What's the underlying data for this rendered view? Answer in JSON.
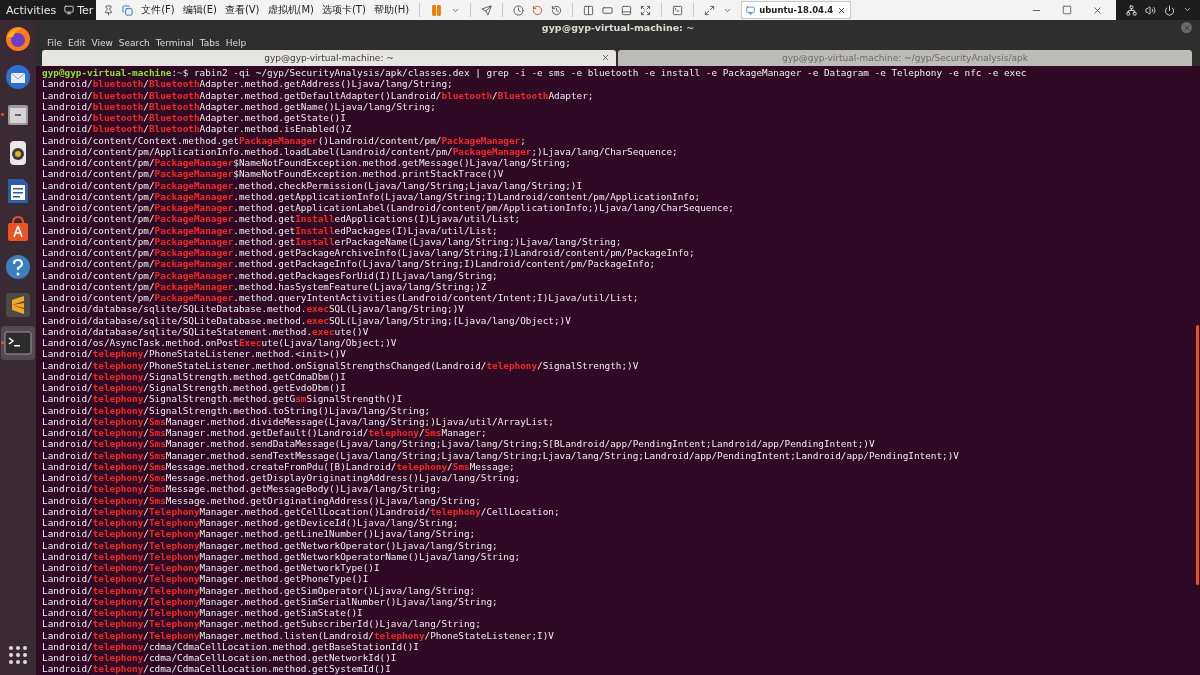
{
  "top_bar": {
    "activities": "Activities",
    "app_menu": "Ter"
  },
  "vm_toolbar": {
    "menus": [
      "文件(F)",
      "编辑(E)",
      "查看(V)",
      "虚拟机(M)",
      "选项卡(T)",
      "帮助(H)"
    ],
    "tab": "ubuntu-18.04.4"
  },
  "dock": [
    {
      "kind": "browser",
      "running": false,
      "selected": false
    },
    {
      "kind": "mail",
      "running": false,
      "selected": false
    },
    {
      "kind": "files",
      "running": true,
      "selected": false
    },
    {
      "kind": "speaker",
      "running": false,
      "selected": false
    },
    {
      "kind": "document",
      "running": false,
      "selected": false
    },
    {
      "kind": "store",
      "running": false,
      "selected": false
    },
    {
      "kind": "help",
      "running": false,
      "selected": false
    },
    {
      "kind": "editor",
      "running": false,
      "selected": false
    },
    {
      "kind": "terminal",
      "running": true,
      "selected": true
    }
  ],
  "terminal": {
    "title": "gyp@gyp-virtual-machine: ~",
    "menu": [
      "File",
      "Edit",
      "View",
      "Search",
      "Terminal",
      "Tabs",
      "Help"
    ],
    "tabs": [
      {
        "label": "gyp@gyp-virtual-machine: ~",
        "selected": true,
        "close_button": true
      },
      {
        "label": "gyp@gyp-virtual-machine: ~/gyp/SecurityAnalysis/apk",
        "selected": false
      }
    ],
    "prompt": {
      "user_host": "gyp@gyp-virtual-machine",
      "separator": ":",
      "path": "~",
      "command": "$ rabin2 -qi ~/gyp/SecurityAnalysis/apk/classes.dex | grep -i -e sms -e bluetooth -e install -e PackageManager -e Datagram -e Telephony -e nfc -e exec"
    },
    "lines": [
      [
        "Landroid/",
        "bluetooth",
        "/",
        "Bluetooth",
        "Adapter.method.getAddress()Ljava/lang/String;"
      ],
      [
        "Landroid/",
        "bluetooth",
        "/",
        "Bluetooth",
        "Adapter.method.getDefaultAdapter()Landroid/",
        "bluetooth",
        "/",
        "Bluetooth",
        "Adapter;"
      ],
      [
        "Landroid/",
        "bluetooth",
        "/",
        "Bluetooth",
        "Adapter.method.getName()Ljava/lang/String;"
      ],
      [
        "Landroid/",
        "bluetooth",
        "/",
        "Bluetooth",
        "Adapter.method.getState()I"
      ],
      [
        "Landroid/",
        "bluetooth",
        "/",
        "Bluetooth",
        "Adapter.method.isEnabled()Z"
      ],
      [
        "Landroid/content/Context.method.get",
        "PackageManager",
        "()Landroid/content/pm/",
        "PackageManager",
        ";"
      ],
      [
        "Landroid/content/pm/ApplicationInfo.method.loadLabel(Landroid/content/pm/",
        "PackageManager",
        ";)Ljava/lang/CharSequence;"
      ],
      [
        "Landroid/content/pm/",
        "PackageManager",
        "$NameNotFoundException.method.getMessage()Ljava/lang/String;"
      ],
      [
        "Landroid/content/pm/",
        "PackageManager",
        "$NameNotFoundException.method.printStackTrace()V"
      ],
      [
        "Landroid/content/pm/",
        "PackageManager",
        ".method.checkPermission(Ljava/lang/String;Ljava/lang/String;)I"
      ],
      [
        "Landroid/content/pm/",
        "PackageManager",
        ".method.getApplicationInfo(Ljava/lang/String;I)Landroid/content/pm/ApplicationInfo;"
      ],
      [
        "Landroid/content/pm/",
        "PackageManager",
        ".method.getApplicationLabel(Landroid/content/pm/ApplicationInfo;)Ljava/lang/CharSequence;"
      ],
      [
        "Landroid/content/pm/",
        "PackageManager",
        ".method.get",
        "Install",
        "edApplications(I)Ljava/util/List;"
      ],
      [
        "Landroid/content/pm/",
        "PackageManager",
        ".method.get",
        "Install",
        "edPackages(I)Ljava/util/List;"
      ],
      [
        "Landroid/content/pm/",
        "PackageManager",
        ".method.get",
        "Install",
        "erPackageName(Ljava/lang/String;)Ljava/lang/String;"
      ],
      [
        "Landroid/content/pm/",
        "PackageManager",
        ".method.getPackageArchiveInfo(Ljava/lang/String;I)Landroid/content/pm/PackageInfo;"
      ],
      [
        "Landroid/content/pm/",
        "PackageManager",
        ".method.getPackageInfo(Ljava/lang/String;I)Landroid/content/pm/PackageInfo;"
      ],
      [
        "Landroid/content/pm/",
        "PackageManager",
        ".method.getPackagesForUid(I)[Ljava/lang/String;"
      ],
      [
        "Landroid/content/pm/",
        "PackageManager",
        ".method.hasSystemFeature(Ljava/lang/String;)Z"
      ],
      [
        "Landroid/content/pm/",
        "PackageManager",
        ".method.queryIntentActivities(Landroid/content/Intent;I)Ljava/util/List;"
      ],
      [
        "Landroid/database/sqlite/SQLiteDatabase.method.",
        "exec",
        "SQL(Ljava/lang/String;)V"
      ],
      [
        "Landroid/database/sqlite/SQLiteDatabase.method.",
        "exec",
        "SQL(Ljava/lang/String;[Ljava/lang/Object;)V"
      ],
      [
        "Landroid/database/sqlite/SQLiteStatement.method.",
        "exec",
        "ute()V"
      ],
      [
        "Landroid/os/AsyncTask.method.onPost",
        "Exec",
        "ute(Ljava/lang/Object;)V"
      ],
      [
        "Landroid/",
        "telephony",
        "/PhoneStateListener.method.<init>()V"
      ],
      [
        "Landroid/",
        "telephony",
        "/PhoneStateListener.method.onSignalStrengthsChanged(Landroid/",
        "telephony",
        "/SignalStrength;)V"
      ],
      [
        "Landroid/",
        "telephony",
        "/SignalStrength.method.getCdmaDbm()I"
      ],
      [
        "Landroid/",
        "telephony",
        "/SignalStrength.method.getEvdoDbm()I"
      ],
      [
        "Landroid/",
        "telephony",
        "/SignalStrength.method.getG",
        "sm",
        "SignalStrength()I"
      ],
      [
        "Landroid/",
        "telephony",
        "/SignalStrength.method.toString()Ljava/lang/String;"
      ],
      [
        "Landroid/",
        "telephony",
        "/",
        "Sms",
        "Manager.method.divideMessage(Ljava/lang/String;)Ljava/util/ArrayList;"
      ],
      [
        "Landroid/",
        "telephony",
        "/",
        "Sms",
        "Manager.method.getDefault()Landroid/",
        "telephony",
        "/",
        "Sms",
        "Manager;"
      ],
      [
        "Landroid/",
        "telephony",
        "/",
        "Sms",
        "Manager.method.sendDataMessage(Ljava/lang/String;Ljava/lang/String;S[BLandroid/app/PendingIntent;Landroid/app/PendingIntent;)V"
      ],
      [
        "Landroid/",
        "telephony",
        "/",
        "Sms",
        "Manager.method.sendTextMessage(Ljava/lang/String;Ljava/lang/String;Ljava/lang/String;Landroid/app/PendingIntent;Landroid/app/PendingIntent;)V"
      ],
      [
        "Landroid/",
        "telephony",
        "/",
        "Sms",
        "Message.method.createFromPdu([B)Landroid/",
        "telephony",
        "/",
        "Sms",
        "Message;"
      ],
      [
        "Landroid/",
        "telephony",
        "/",
        "Sms",
        "Message.method.getDisplayOriginatingAddress()Ljava/lang/String;"
      ],
      [
        "Landroid/",
        "telephony",
        "/",
        "Sms",
        "Message.method.getMessageBody()Ljava/lang/String;"
      ],
      [
        "Landroid/",
        "telephony",
        "/",
        "Sms",
        "Message.method.getOriginatingAddress()Ljava/lang/String;"
      ],
      [
        "Landroid/",
        "telephony",
        "/",
        "Telephony",
        "Manager.method.getCellLocation()Landroid/",
        "telephony",
        "/CellLocation;"
      ],
      [
        "Landroid/",
        "telephony",
        "/",
        "Telephony",
        "Manager.method.getDeviceId()Ljava/lang/String;"
      ],
      [
        "Landroid/",
        "telephony",
        "/",
        "Telephony",
        "Manager.method.getLine1Number()Ljava/lang/String;"
      ],
      [
        "Landroid/",
        "telephony",
        "/",
        "Telephony",
        "Manager.method.getNetworkOperator()Ljava/lang/String;"
      ],
      [
        "Landroid/",
        "telephony",
        "/",
        "Telephony",
        "Manager.method.getNetworkOperatorName()Ljava/lang/String;"
      ],
      [
        "Landroid/",
        "telephony",
        "/",
        "Telephony",
        "Manager.method.getNetworkType()I"
      ],
      [
        "Landroid/",
        "telephony",
        "/",
        "Telephony",
        "Manager.method.getPhoneType()I"
      ],
      [
        "Landroid/",
        "telephony",
        "/",
        "Telephony",
        "Manager.method.getSimOperator()Ljava/lang/String;"
      ],
      [
        "Landroid/",
        "telephony",
        "/",
        "Telephony",
        "Manager.method.getSimSerialNumber()Ljava/lang/String;"
      ],
      [
        "Landroid/",
        "telephony",
        "/",
        "Telephony",
        "Manager.method.getSimState()I"
      ],
      [
        "Landroid/",
        "telephony",
        "/",
        "Telephony",
        "Manager.method.getSubscriberId()Ljava/lang/String;"
      ],
      [
        "Landroid/",
        "telephony",
        "/",
        "Telephony",
        "Manager.method.listen(Landroid/",
        "telephony",
        "/PhoneStateListener;I)V"
      ],
      [
        "Landroid/",
        "telephony",
        "/cdma/CdmaCellLocation.method.getBaseStationId()I"
      ],
      [
        "Landroid/",
        "telephony",
        "/cdma/CdmaCellLocation.method.getNetworkId()I"
      ],
      [
        "Landroid/",
        "telephony",
        "/cdma/CdmaCellLocation.method.getSystemId()I"
      ]
    ]
  }
}
